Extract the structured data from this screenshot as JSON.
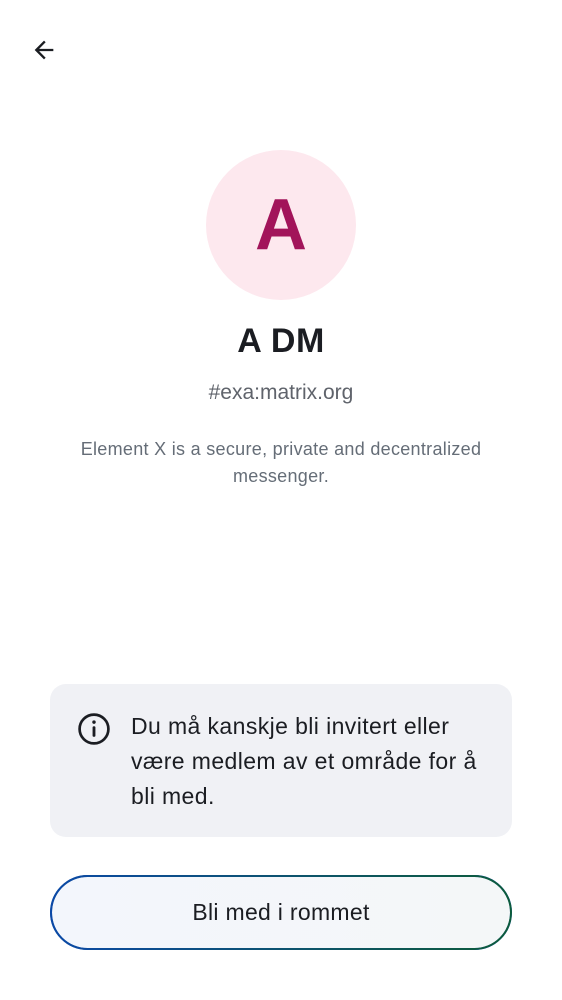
{
  "colors": {
    "avatar_bg": "#fde8ee",
    "avatar_letter": "#a2145a",
    "info_bg": "#f0f1f5",
    "button_border_start": "#0b49a6",
    "button_border_end": "#0d5c3a"
  },
  "header": {
    "back_icon": "arrow-left-icon"
  },
  "room": {
    "avatar_letter": "A",
    "name": "A DM",
    "alias": "#exa:matrix.org",
    "description": "Element X is a secure, private and decentralized messenger."
  },
  "notice": {
    "icon": "info-icon",
    "text": "Du må kanskje bli invitert eller være medlem av et område for å bli med."
  },
  "actions": {
    "join_label": "Bli med i rommet"
  }
}
